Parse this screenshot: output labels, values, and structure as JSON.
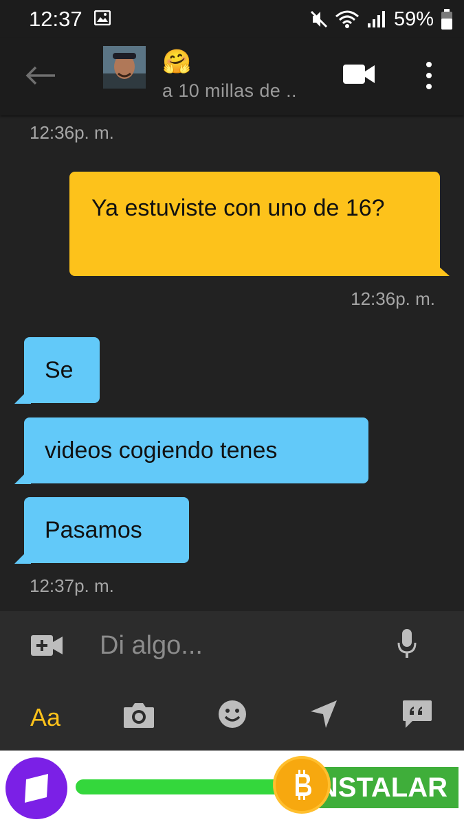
{
  "status_bar": {
    "time": "12:37",
    "battery": "59%",
    "icons": [
      "image-icon",
      "mute-icon",
      "wifi-icon",
      "signal-icon",
      "battery-icon"
    ]
  },
  "header": {
    "name_emoji": "🤗",
    "distance": "a 10 millas de ..",
    "icons": [
      "back-arrow-icon",
      "video-call-icon",
      "more-vert-icon"
    ]
  },
  "messages": {
    "top_timestamp": "12:36p. m.",
    "outgoing": {
      "text": "Ya estuviste con uno de 16?",
      "timestamp": "12:36p. m."
    },
    "incoming": [
      {
        "text": "Se"
      },
      {
        "text": "videos cogiendo tenes"
      },
      {
        "text": "Pasamos"
      }
    ],
    "incoming_timestamp": "12:37p. m."
  },
  "composer": {
    "placeholder": "Di algo...",
    "format_label": "Aa",
    "icons": [
      "video-add-icon",
      "microphone-icon",
      "camera-icon",
      "emoji-icon",
      "location-arrow-icon",
      "quote-icon"
    ]
  },
  "ad": {
    "install_label": "NSTALAR"
  },
  "colors": {
    "background": "#222222",
    "outgoing_bubble": "#fdc21b",
    "incoming_bubble": "#62c9f9",
    "accent": "#fdc21b",
    "ad_green": "#3fae3a"
  }
}
